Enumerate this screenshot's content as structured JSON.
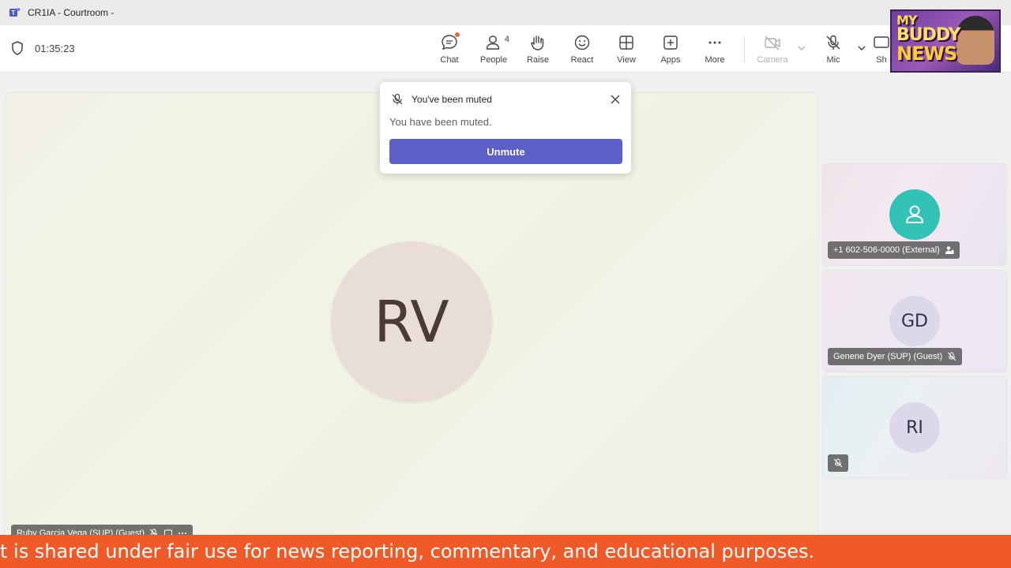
{
  "window": {
    "title": "CR1IA - Courtroom -"
  },
  "toolbar": {
    "timer": "01:35:23",
    "chat_label": "Chat",
    "people_label": "People",
    "people_count": "4",
    "raise_label": "Raise",
    "react_label": "React",
    "view_label": "View",
    "apps_label": "Apps",
    "more_label": "More",
    "camera_label": "Camera",
    "mic_label": "Mic",
    "share_label": "Sh"
  },
  "overlay_logo": {
    "line1": "MY",
    "line2": "BUDDY",
    "line3": "NEWS"
  },
  "notification": {
    "title": "You've been muted",
    "body": "You have been muted.",
    "button": "Unmute"
  },
  "stage": {
    "initials": "RV",
    "name": "Ruby Garcia Vega (SUP) (Guest)"
  },
  "participants": [
    {
      "initials": "",
      "name": "+1 602-506-0000 (External)",
      "avatar_color": "#33c2b6"
    },
    {
      "initials": "GD",
      "name": "Genene Dyer (SUP) (Guest)",
      "avatar_color": "#dcd8ea"
    },
    {
      "initials": "RI",
      "name": "",
      "avatar_color": "#dcd8ea"
    }
  ],
  "ticker": {
    "text": "t is shared under fair use for news reporting, commentary, and educational purposes."
  },
  "colors": {
    "accent": "#5b5fc7",
    "ticker": "#ef5a28",
    "notify_dot": "#e8673d"
  }
}
